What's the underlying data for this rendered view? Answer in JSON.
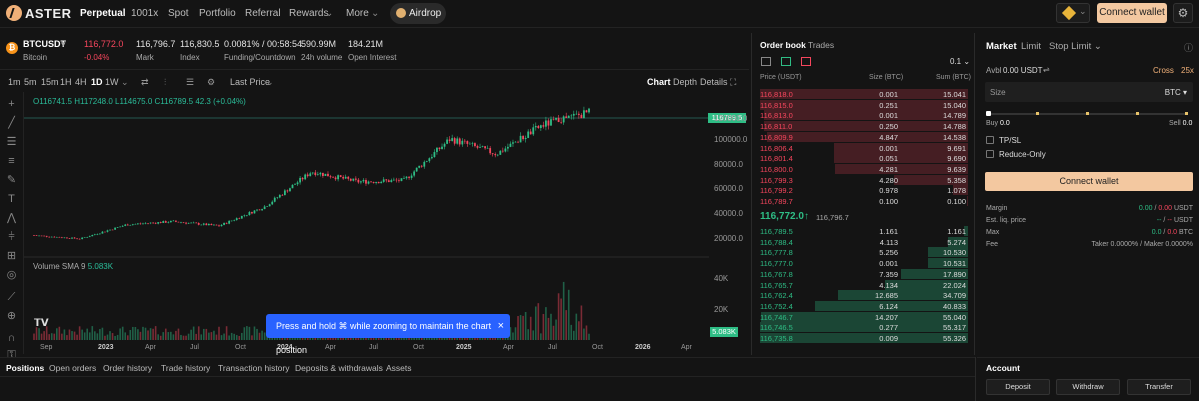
{
  "header": {
    "brand": "ASTER",
    "nav": [
      "Perpetual",
      "1001x",
      "Spot",
      "Portfolio",
      "Referral",
      "Rewards",
      "More"
    ],
    "airdrop": "Airdrop",
    "connect": "Connect wallet"
  },
  "ticker": {
    "symbol": "BTCUSDT",
    "coin": "Bitcoin",
    "last": "116,772.0",
    "change": "-0.04%",
    "mark": "116,796.7",
    "mark_label": "Mark",
    "index": "116,830.5",
    "index_label": "Index",
    "funding": "0.0081% / 00:58:54",
    "funding_label": "Funding/Countdown",
    "volume": "590.99M",
    "volume_label": "24h volume",
    "oi": "184.21M",
    "oi_label": "Open Interest"
  },
  "chart_toolbar": {
    "timeframes": [
      "1m",
      "5m",
      "15m",
      "1H",
      "4H",
      "1D",
      "1W"
    ],
    "price_mode": "Last Price",
    "views": [
      "Chart",
      "Depth",
      "Details"
    ]
  },
  "ohlc": {
    "o": "O",
    "ov": "116741.5",
    "h": "H",
    "hv": "117248.0",
    "l": "L",
    "lv": "114675.0",
    "c": "C",
    "cv": "116789.5",
    "chg": "42.3 (+0.04%)"
  },
  "volume": {
    "label": "Volume SMA 9",
    "value": "5.083K",
    "last": "5.083K"
  },
  "price_tag": "116789.5",
  "tooltip": "Press and hold ⌘ while zooming to maintain the chart position",
  "chart_data": {
    "type": "candlestick",
    "title": "",
    "xlabel": "",
    "ylabel": "",
    "y_ticks": [
      "120000.0",
      "100000.0",
      "80000.0",
      "60000.0",
      "40000.0",
      "20000.0"
    ],
    "vol_ticks": [
      "40K",
      "20K"
    ],
    "x_ticks": [
      "Sep",
      "2023",
      "Apr",
      "Jul",
      "Oct",
      "2024",
      "Apr",
      "Jul",
      "Oct",
      "2025",
      "Apr",
      "Jul",
      "Oct",
      "2026",
      "Apr"
    ],
    "ylim": [
      0,
      130000
    ],
    "series": [
      {
        "name": "",
        "x": [
          "2022-09",
          "2022-12",
          "2023-03",
          "2023-06",
          "2023-09",
          "2023-12",
          "2024-03",
          "2024-06",
          "2024-09",
          "2024-12",
          "2025-03",
          "2025-06",
          "2025-08"
        ],
        "values": [
          19500,
          16800,
          28000,
          30500,
          27000,
          42500,
          70000,
          62000,
          63000,
          96000,
          84000,
          107000,
          116789.5
        ]
      }
    ]
  },
  "book": {
    "tabs": [
      "Order book",
      "Trades"
    ],
    "tick": "0.1",
    "headers": [
      "Price (USDT)",
      "Size (BTC)",
      "Sum (BTC)"
    ],
    "asks": [
      [
        "116,818.0",
        "0.001",
        "15.041"
      ],
      [
        "116,815.0",
        "0.251",
        "15.040"
      ],
      [
        "116,813.0",
        "0.001",
        "14.789"
      ],
      [
        "116,811.0",
        "0.250",
        "14.788"
      ],
      [
        "116,809.9",
        "4.847",
        "14.538"
      ],
      [
        "116,806.4",
        "0.001",
        "9.691"
      ],
      [
        "116,801.4",
        "0.051",
        "9.690"
      ],
      [
        "116,800.0",
        "4.281",
        "9.639"
      ],
      [
        "116,799.3",
        "4.280",
        "5.358"
      ],
      [
        "116,799.2",
        "0.978",
        "1.078"
      ],
      [
        "116,789.7",
        "0.100",
        "0.100"
      ]
    ],
    "mid": "116,772.0",
    "mid_arrow": "↑",
    "mark": "116,796.7",
    "bids": [
      [
        "116,789.5",
        "1.161",
        "1.161"
      ],
      [
        "116,788.4",
        "4.113",
        "5.274"
      ],
      [
        "116,777.8",
        "5.256",
        "10.530"
      ],
      [
        "116,777.0",
        "0.001",
        "10.531"
      ],
      [
        "116,767.8",
        "7.359",
        "17.890"
      ],
      [
        "116,765.7",
        "4.134",
        "22.024"
      ],
      [
        "116,762.4",
        "12.685",
        "34.709"
      ],
      [
        "116,752.4",
        "6.124",
        "40.833"
      ],
      [
        "116,746.7",
        "14.207",
        "55.040"
      ],
      [
        "116,746.5",
        "0.277",
        "55.317"
      ],
      [
        "116,735.8",
        "0.009",
        "55.326"
      ]
    ]
  },
  "order": {
    "types": [
      "Market",
      "Limit",
      "Stop Limit"
    ],
    "avbl_label": "Avbl",
    "avbl": "0.00 USDT",
    "margin_mode": "Cross",
    "leverage": "25x",
    "size": "Size",
    "size_unit": "BTC",
    "buy": "Buy",
    "buy_v": "0.0",
    "sell": "Sell",
    "sell_v": "0.0",
    "tpsl": "TP/SL",
    "reduce": "Reduce-Only",
    "connect": "Connect wallet",
    "margin_label": "Margin",
    "margin_a": "0.00",
    "margin_b": "0.00",
    "margin_unit": "USDT",
    "liq_label": "Est. liq. price",
    "liq_a": "--",
    "liq_b": "--",
    "liq_unit": "USDT",
    "max_label": "Max",
    "max_a": "0.0",
    "max_b": "0.0",
    "max_unit": "BTC",
    "fee_label": "Fee",
    "fee": "Taker 0.0000% / Maker 0.0000%"
  },
  "bottom_tabs": [
    "Positions",
    "Open orders",
    "Order history",
    "Trade history",
    "Transaction history",
    "Deposits & withdrawals",
    "Assets"
  ],
  "account": {
    "title": "Account",
    "buttons": [
      "Deposit",
      "Withdraw",
      "Transfer"
    ]
  },
  "colors": {
    "up": "#2ebd85",
    "down": "#f6465d",
    "accent": "#f3c8a0"
  }
}
